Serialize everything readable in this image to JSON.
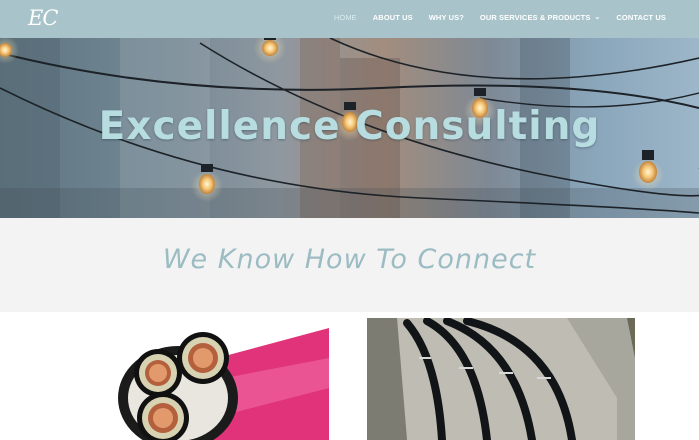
{
  "header": {
    "logo": "EC",
    "nav": [
      {
        "label": "HOME",
        "active": true
      },
      {
        "label": "ABOUT US",
        "active": false
      },
      {
        "label": "WHY US?",
        "active": false
      },
      {
        "label": "OUR SERVICES & PRODUCTS",
        "active": false,
        "dropdown": true
      },
      {
        "label": "CONTACT US",
        "active": false
      }
    ],
    "chevron": "⌄"
  },
  "hero": {
    "title": "Excellence Consulting"
  },
  "band": {
    "tagline": "We Know How To Connect"
  },
  "colors": {
    "header_bg": "#a8c3ca",
    "hero_title": "#b7dde0",
    "tagline": "#9cbcc3",
    "band_bg": "#f3f3f3"
  }
}
